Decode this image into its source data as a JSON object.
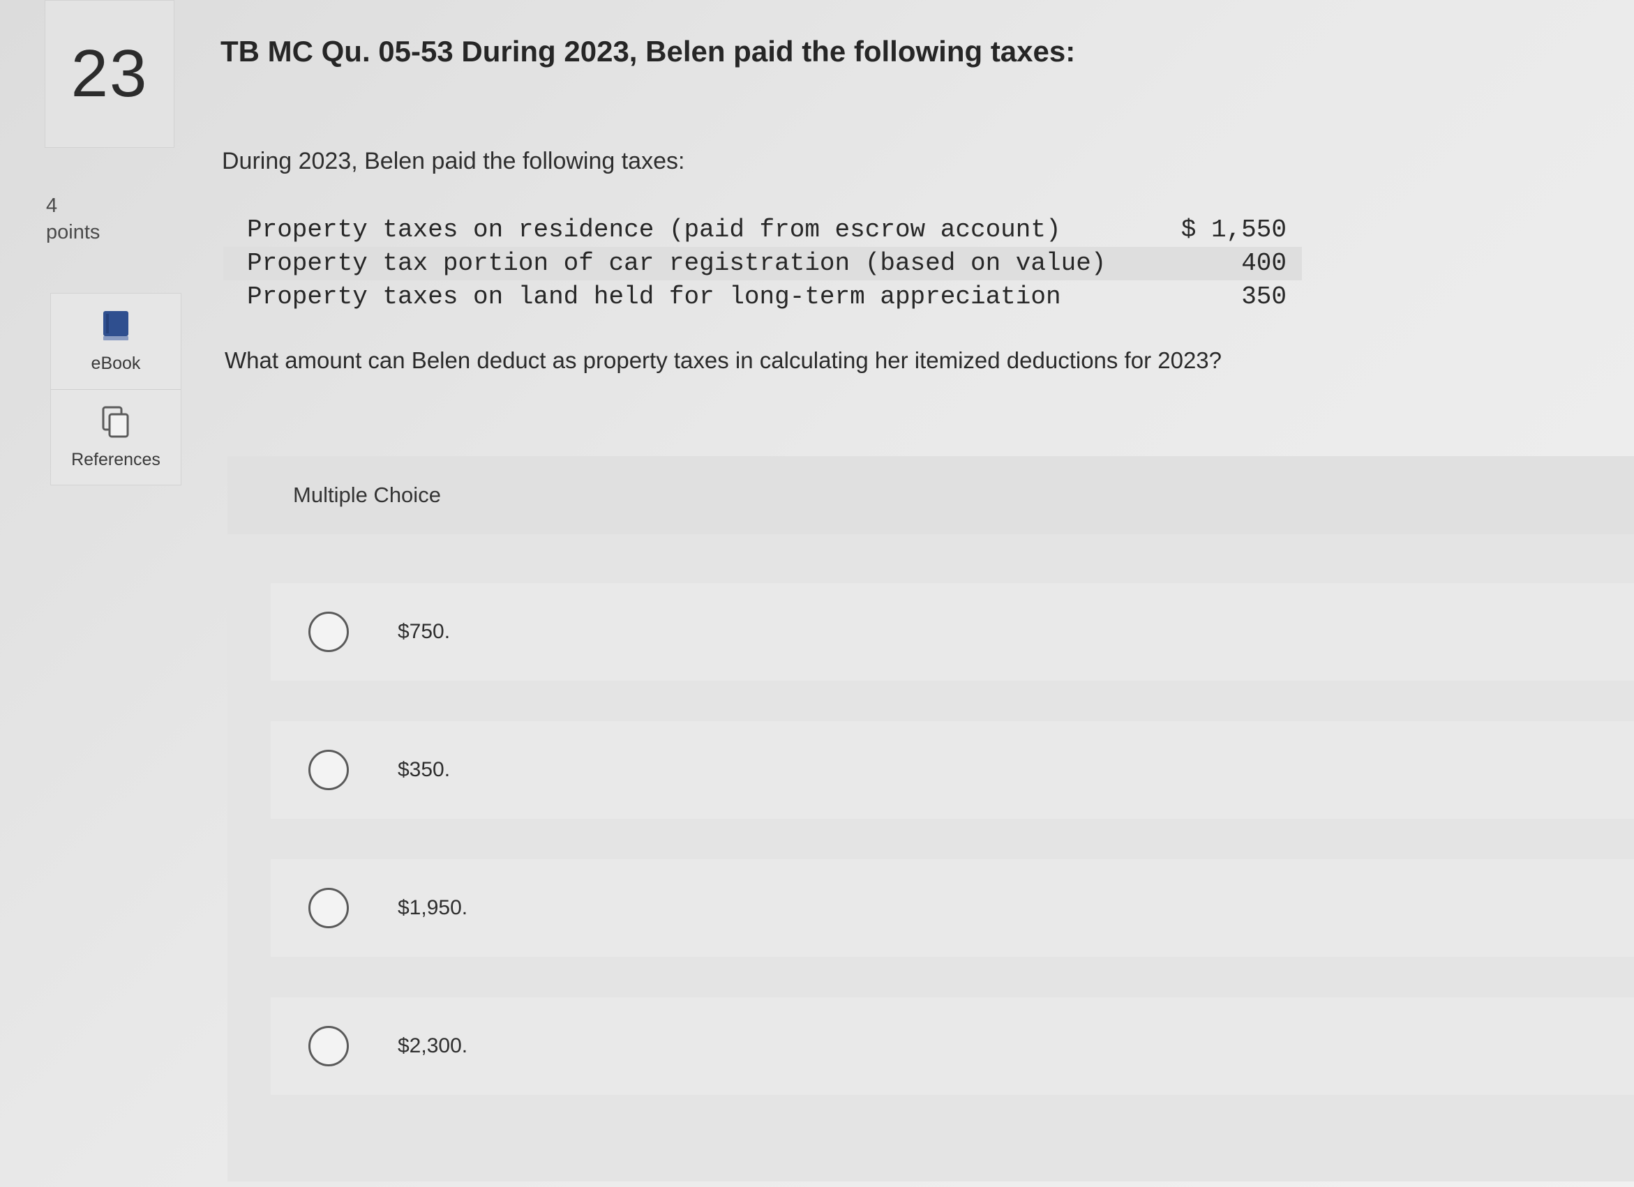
{
  "question": {
    "number": "23",
    "points_value": "4",
    "points_label": "points",
    "title": "TB MC Qu. 05-53 During 2023, Belen paid the following taxes:",
    "intro": "During 2023, Belen paid the following taxes:",
    "taxes": [
      {
        "label": "Property taxes on residence (paid from escrow account)",
        "amount": "$ 1,550"
      },
      {
        "label": "Property tax portion of car registration (based on value)",
        "amount": "400"
      },
      {
        "label": "Property taxes on land held for long-term appreciation",
        "amount": "350"
      }
    ],
    "prompt": "What amount can Belen deduct as property taxes in calculating her itemized deductions for 2023?"
  },
  "tools": {
    "ebook": {
      "label": "eBook",
      "icon": "book-icon"
    },
    "references": {
      "label": "References",
      "icon": "references-icon"
    }
  },
  "multiple_choice": {
    "header": "Multiple Choice",
    "options": [
      {
        "label": "$750."
      },
      {
        "label": "$350."
      },
      {
        "label": "$1,950."
      },
      {
        "label": "$2,300."
      }
    ]
  },
  "colors": {
    "ebook_icon": "#2f4f8f",
    "radio_border": "#5a5a5a"
  }
}
